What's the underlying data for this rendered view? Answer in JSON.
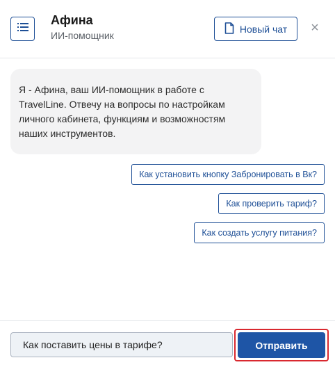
{
  "header": {
    "title": "Афина",
    "subtitle": "ИИ-помощник",
    "menu_icon": "list-icon",
    "new_chat_icon": "document-icon",
    "new_chat_label": "Новый чат",
    "close_label": "×"
  },
  "messages": [
    {
      "sender": "assistant",
      "text": "Я - Афина, ваш ИИ-помощник в работе с TravelLine. Отвечу на вопросы по настройкам личного кабинета, функциям и возможностям наших инструментов."
    }
  ],
  "suggestions": [
    {
      "label": "Как установить кнопку Забронировать в Вк?"
    },
    {
      "label": "Как проверить тариф?"
    },
    {
      "label": "Как создать услугу питания?"
    }
  ],
  "composer": {
    "input_value": "Как поставить цены в тарифе?",
    "send_label": "Отправить"
  },
  "colors": {
    "accent": "#1e4f96",
    "send_button": "#1e55a6",
    "highlight_border": "#d9282f",
    "bubble_bg": "#f3f3f4",
    "input_bg": "#eef2f6"
  }
}
